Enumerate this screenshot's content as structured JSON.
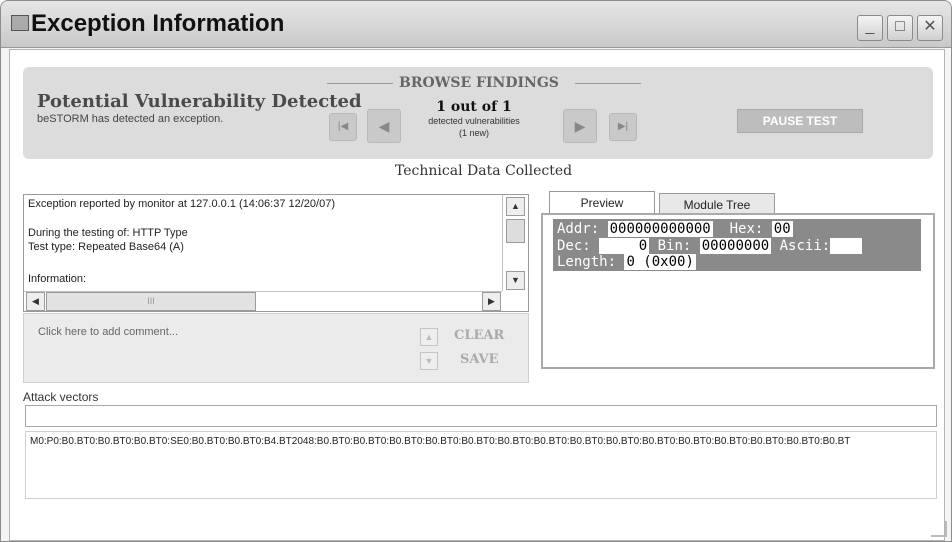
{
  "window": {
    "title": "Exception Information",
    "controls": {
      "minimize": "_",
      "maximize": "□",
      "close": "✕"
    }
  },
  "banner": {
    "title": "Potential Vulnerability Detected",
    "subtitle": "beSTORM has detected an exception.",
    "browse_heading": "BROWSE FINDINGS",
    "count": "1 out of 1",
    "count_sub": "detected vulnerabilities",
    "count_new": "(1 new)",
    "pause_label": "PAUSE TEST",
    "buttons": {
      "first": "|◀",
      "prev": "◀",
      "next": "▶",
      "last": "▶|"
    }
  },
  "tech": {
    "heading": "Technical Data Collected",
    "log_lines": [
      "Exception reported by monitor at 127.0.0.1 (14:06:37 12/20/07)",
      "During the testing of: HTTP Type",
      "Test type: Repeated Base64 (A)",
      "Information:"
    ],
    "scroll": {
      "up": "▲",
      "down": "▼",
      "left": "◀",
      "right": "▶",
      "thumb": "III"
    },
    "comment_placeholder": "Click here to add comment...",
    "clear_label": "CLEAR",
    "save_label": "SAVE"
  },
  "tabs": [
    {
      "label": "Preview",
      "active": true
    },
    {
      "label": "Module Tree",
      "active": false
    }
  ],
  "preview": {
    "addr_label": "Addr:",
    "addr_value": "000000000000",
    "hex_label": "Hex:",
    "hex_value": "00",
    "dec_label": "Dec:",
    "dec_value": "0",
    "bin_label": "Bin:",
    "bin_value": "00000000",
    "ascii_label": "Ascii:",
    "ascii_value": "",
    "length_label": "Length:",
    "length_value": "0 (0x00)"
  },
  "attack": {
    "label": "Attack vectors",
    "input_value": "",
    "list_text": "M0:P0:B0.BT0:B0.BT0:B0.BT0:SE0:B0.BT0:B0.BT0:B4.BT2048:B0.BT0:B0.BT0:B0.BT0:B0.BT0:B0.BT0:B0.BT0:B0.BT0:B0.BT0:B0.BT0:B0.BT0:B0.BT0:B0.BT0:B0.BT0:B0.BT0:B0.BT"
  }
}
